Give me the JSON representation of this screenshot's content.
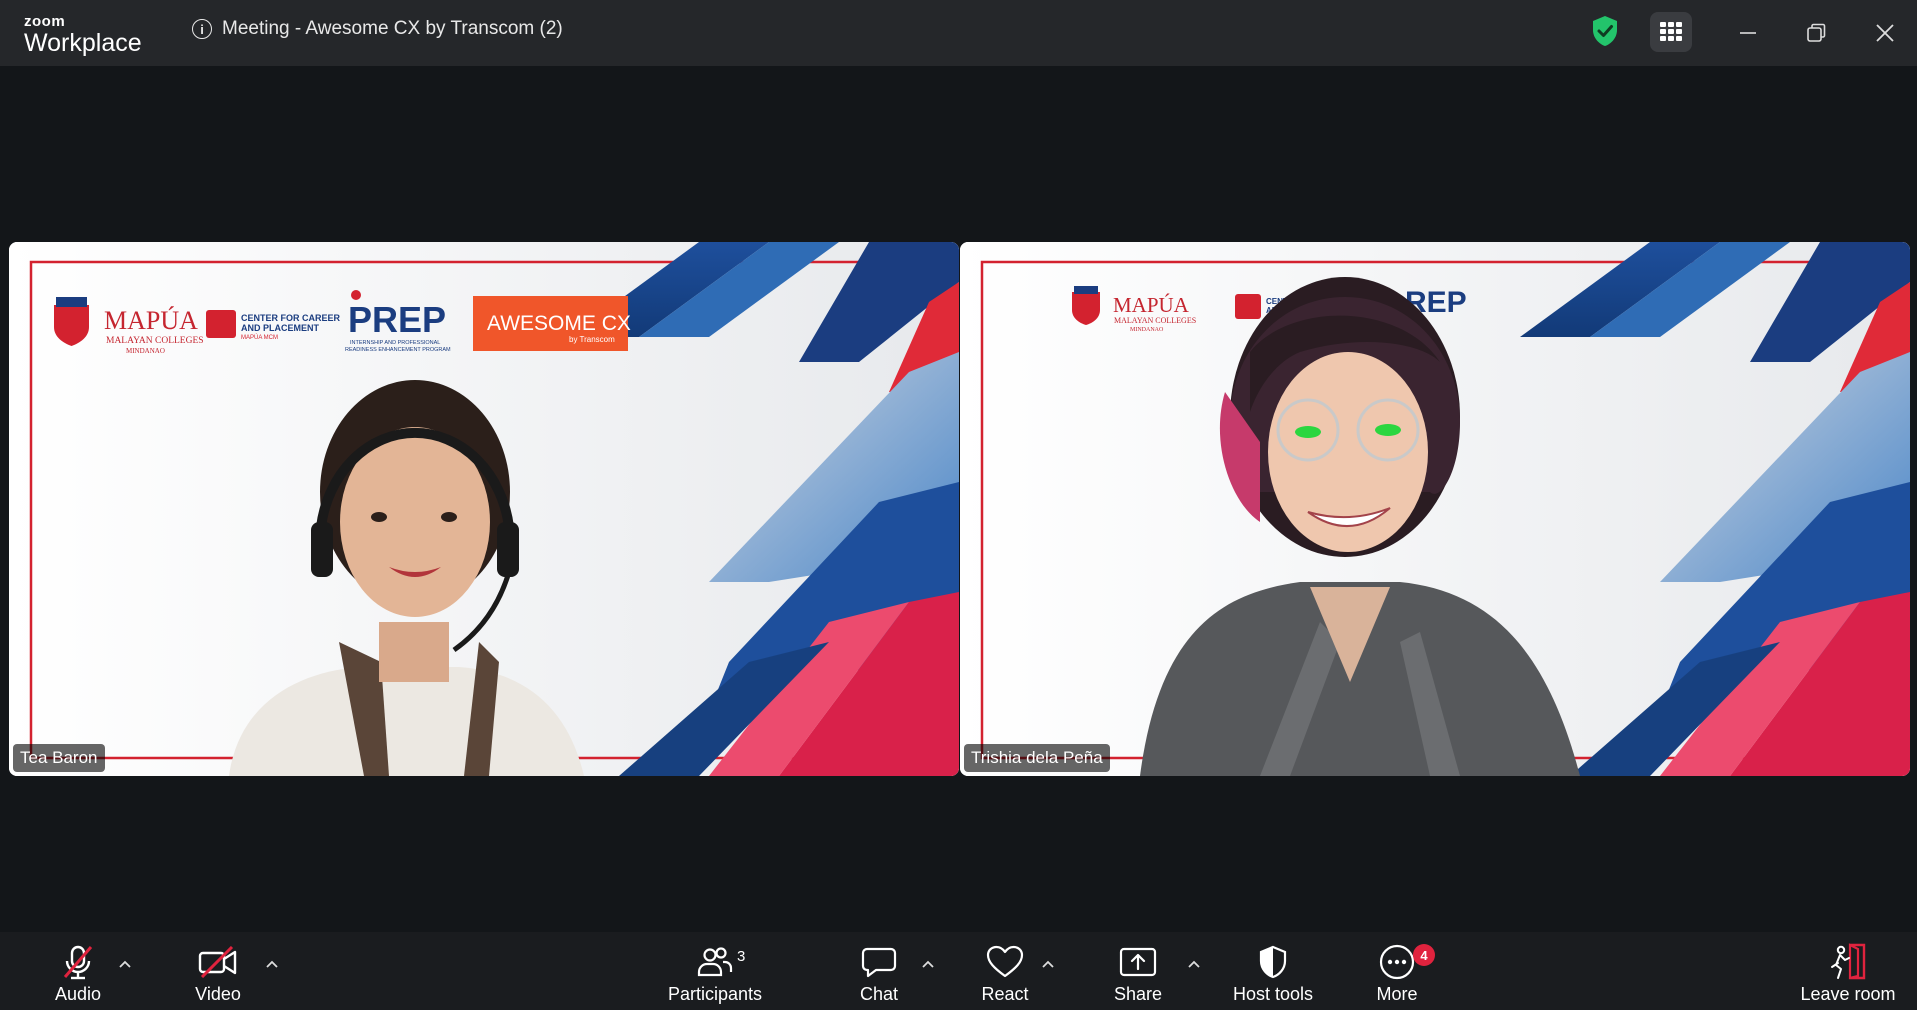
{
  "app": {
    "brand": "zoom",
    "product": "Workplace"
  },
  "meeting": {
    "title": "Meeting - Awesome CX by Transcom (2)"
  },
  "participants": [
    {
      "name": "Tea Baron",
      "backdrop": {
        "mapua": "MAPÚA",
        "mapua_sub": "MALAYAN COLLEGES",
        "mapua_sub2": "MINDANAO",
        "ccp_line1": "CENTER FOR CAREER",
        "ccp_line2": "AND PLACEMENT",
        "ccp_line3": "MAPÚA MCM",
        "prep": "PREP",
        "prep_sub1": "INTERNSHIP AND PROFESSIONAL",
        "prep_sub2": "READINESS ENHANCEMENT PROGRAM",
        "awesome": "AWESOME CX",
        "awesome_sub": "by Transcom"
      }
    },
    {
      "name": "Trishia dela Peña",
      "backdrop": {
        "mapua": "MAPÚA",
        "mapua_sub": "MALAYAN COLLEGES",
        "mapua_sub2": "MINDANAO",
        "ccp_line1": "CENTER FOR C",
        "ccp_line2": "AND PLACE",
        "prep": "REP"
      }
    }
  ],
  "toolbar": {
    "audio": "Audio",
    "video": "Video",
    "participants": "Participants",
    "participants_count": "3",
    "chat": "Chat",
    "react": "React",
    "share": "Share",
    "host_tools": "Host tools",
    "more": "More",
    "more_badge": "4",
    "leave": "Leave room"
  },
  "colors": {
    "accent_red": "#e0233e",
    "brand_blue": "#1f3f8f",
    "awesome_orange": "#f0562a",
    "shield_green": "#23c46b"
  }
}
